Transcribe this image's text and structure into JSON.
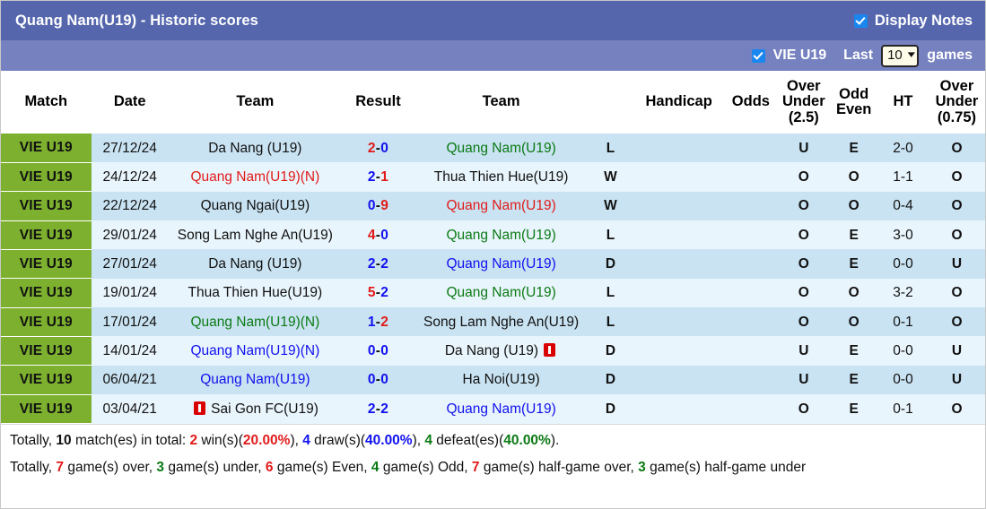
{
  "header": {
    "title": "Quang Nam(U19) - Historic scores",
    "display_notes_label": "Display Notes",
    "display_notes_checked": true,
    "league_filter_label": "VIE U19",
    "league_filter_checked": true,
    "last_label": "Last",
    "games_label": "games",
    "games_count": "10",
    "bar_color": "#5566ad",
    "subbar_color": "#7681c0"
  },
  "table": {
    "columns": [
      {
        "key": "match",
        "label": "Match"
      },
      {
        "key": "date",
        "label": "Date"
      },
      {
        "key": "team_home",
        "label": "Team"
      },
      {
        "key": "result",
        "label": "Result"
      },
      {
        "key": "team_away",
        "label": "Team"
      },
      {
        "key": "wl",
        "label": ""
      },
      {
        "key": "handicap",
        "label": "Handicap"
      },
      {
        "key": "odds",
        "label": "Odds"
      },
      {
        "key": "over_under_25",
        "label": "Over Under (2.5)"
      },
      {
        "key": "odd_even",
        "label": "Odd Even"
      },
      {
        "key": "ht",
        "label": "HT"
      },
      {
        "key": "over_under_075",
        "label": "Over Under (0.75)"
      }
    ],
    "col_over_under_25_lines": [
      "Over",
      "Under",
      "(2.5)"
    ],
    "col_odd_even_lines": [
      "Odd",
      "Even"
    ],
    "col_over_under_075_lines": [
      "Over",
      "Under",
      "(0.75)"
    ],
    "rows": [
      {
        "league": "VIE U19",
        "date": "27/12/24",
        "home": "Da Nang (U19)",
        "home_color": "black",
        "home_card": false,
        "score_home": "2",
        "score_away": "0",
        "score_home_color": "red",
        "score_away_color": "blue",
        "away": "Quang Nam(U19)",
        "away_color": "green",
        "away_card": false,
        "wl": "L",
        "wl_color": "green",
        "handicap": "",
        "odds": "",
        "ou25": "U",
        "ou25_color": "green",
        "oddeven": "E",
        "oddeven_color": "red",
        "ht": "2-0",
        "ou075": "O",
        "ou075_color": "red"
      },
      {
        "league": "VIE U19",
        "date": "24/12/24",
        "home": "Quang Nam(U19)(N)",
        "home_color": "red",
        "home_card": false,
        "score_home": "2",
        "score_away": "1",
        "score_home_color": "blue",
        "score_away_color": "red",
        "away": "Thua Thien Hue(U19)",
        "away_color": "black",
        "away_card": false,
        "wl": "W",
        "wl_color": "red",
        "handicap": "",
        "odds": "",
        "ou25": "O",
        "ou25_color": "red",
        "oddeven": "O",
        "oddeven_color": "green",
        "ht": "1-1",
        "ou075": "O",
        "ou075_color": "red"
      },
      {
        "league": "VIE U19",
        "date": "22/12/24",
        "home": "Quang Ngai(U19)",
        "home_color": "black",
        "home_card": false,
        "score_home": "0",
        "score_away": "9",
        "score_home_color": "blue",
        "score_away_color": "red",
        "away": "Quang Nam(U19)",
        "away_color": "red",
        "away_card": false,
        "wl": "W",
        "wl_color": "red",
        "handicap": "",
        "odds": "",
        "ou25": "O",
        "ou25_color": "red",
        "oddeven": "O",
        "oddeven_color": "green",
        "ht": "0-4",
        "ou075": "O",
        "ou075_color": "red"
      },
      {
        "league": "VIE U19",
        "date": "29/01/24",
        "home": "Song Lam Nghe An(U19)",
        "home_color": "black",
        "home_card": false,
        "score_home": "4",
        "score_away": "0",
        "score_home_color": "red",
        "score_away_color": "blue",
        "away": "Quang Nam(U19)",
        "away_color": "green",
        "away_card": false,
        "wl": "L",
        "wl_color": "green",
        "handicap": "",
        "odds": "",
        "ou25": "O",
        "ou25_color": "red",
        "oddeven": "E",
        "oddeven_color": "red",
        "ht": "3-0",
        "ou075": "O",
        "ou075_color": "red"
      },
      {
        "league": "VIE U19",
        "date": "27/01/24",
        "home": "Da Nang (U19)",
        "home_color": "black",
        "home_card": false,
        "score_home": "2",
        "score_away": "2",
        "score_home_color": "blue",
        "score_away_color": "blue",
        "away": "Quang Nam(U19)",
        "away_color": "blue",
        "away_card": false,
        "wl": "D",
        "wl_color": "blue",
        "handicap": "",
        "odds": "",
        "ou25": "O",
        "ou25_color": "red",
        "oddeven": "E",
        "oddeven_color": "red",
        "ht": "0-0",
        "ou075": "U",
        "ou075_color": "green"
      },
      {
        "league": "VIE U19",
        "date": "19/01/24",
        "home": "Thua Thien Hue(U19)",
        "home_color": "black",
        "home_card": false,
        "score_home": "5",
        "score_away": "2",
        "score_home_color": "red",
        "score_away_color": "blue",
        "away": "Quang Nam(U19)",
        "away_color": "green",
        "away_card": false,
        "wl": "L",
        "wl_color": "green",
        "handicap": "",
        "odds": "",
        "ou25": "O",
        "ou25_color": "red",
        "oddeven": "O",
        "oddeven_color": "green",
        "ht": "3-2",
        "ou075": "O",
        "ou075_color": "red"
      },
      {
        "league": "VIE U19",
        "date": "17/01/24",
        "home": "Quang Nam(U19)(N)",
        "home_color": "green",
        "home_card": false,
        "score_home": "1",
        "score_away": "2",
        "score_home_color": "blue",
        "score_away_color": "red",
        "away": "Song Lam Nghe An(U19)",
        "away_color": "black",
        "away_card": false,
        "wl": "L",
        "wl_color": "green",
        "handicap": "",
        "odds": "",
        "ou25": "O",
        "ou25_color": "red",
        "oddeven": "O",
        "oddeven_color": "green",
        "ht": "0-1",
        "ou075": "O",
        "ou075_color": "red"
      },
      {
        "league": "VIE U19",
        "date": "14/01/24",
        "home": "Quang Nam(U19)(N)",
        "home_color": "blue",
        "home_card": false,
        "score_home": "0",
        "score_away": "0",
        "score_home_color": "blue",
        "score_away_color": "blue",
        "away": "Da Nang (U19)",
        "away_color": "black",
        "away_card": true,
        "wl": "D",
        "wl_color": "blue",
        "handicap": "",
        "odds": "",
        "ou25": "U",
        "ou25_color": "green",
        "oddeven": "E",
        "oddeven_color": "red",
        "ht": "0-0",
        "ou075": "U",
        "ou075_color": "green"
      },
      {
        "league": "VIE U19",
        "date": "06/04/21",
        "home": "Quang Nam(U19)",
        "home_color": "blue",
        "home_card": false,
        "score_home": "0",
        "score_away": "0",
        "score_home_color": "blue",
        "score_away_color": "blue",
        "away": "Ha Noi(U19)",
        "away_color": "black",
        "away_card": false,
        "wl": "D",
        "wl_color": "blue",
        "handicap": "",
        "odds": "",
        "ou25": "U",
        "ou25_color": "green",
        "oddeven": "E",
        "oddeven_color": "red",
        "ht": "0-0",
        "ou075": "U",
        "ou075_color": "green"
      },
      {
        "league": "VIE U19",
        "date": "03/04/21",
        "home": "Sai Gon FC(U19)",
        "home_color": "black",
        "home_card": true,
        "home_card_before": true,
        "score_home": "2",
        "score_away": "2",
        "score_home_color": "blue",
        "score_away_color": "blue",
        "away": "Quang Nam(U19)",
        "away_color": "blue",
        "away_card": false,
        "wl": "D",
        "wl_color": "blue",
        "handicap": "",
        "odds": "",
        "ou25": "O",
        "ou25_color": "red",
        "oddeven": "E",
        "oddeven_color": "red",
        "ht": "0-1",
        "ou075": "O",
        "ou075_color": "red"
      }
    ]
  },
  "summary": {
    "line1": {
      "t1": "Totally, ",
      "n_total": "10",
      "t2": " match(es) in total: ",
      "n_win": "2",
      "t3": " win(s)(",
      "pct_win": "20.00%",
      "t4": "), ",
      "n_draw": "4",
      "t5": " draw(s)(",
      "pct_draw": "40.00%",
      "t6": "), ",
      "n_def": "4",
      "t7": " defeat(es)(",
      "pct_def": "40.00%",
      "t8": ")."
    },
    "line2": {
      "t1": "Totally, ",
      "n_over": "7",
      "t2": " game(s) over, ",
      "n_under": "3",
      "t3": " game(s) under, ",
      "n_even": "6",
      "t4": " game(s) Even, ",
      "n_odd": "4",
      "t5": " game(s) Odd, ",
      "n_hgover": "7",
      "t6": " game(s) half-game over, ",
      "n_hgunder": "3",
      "t7": " game(s) half-game under"
    }
  }
}
